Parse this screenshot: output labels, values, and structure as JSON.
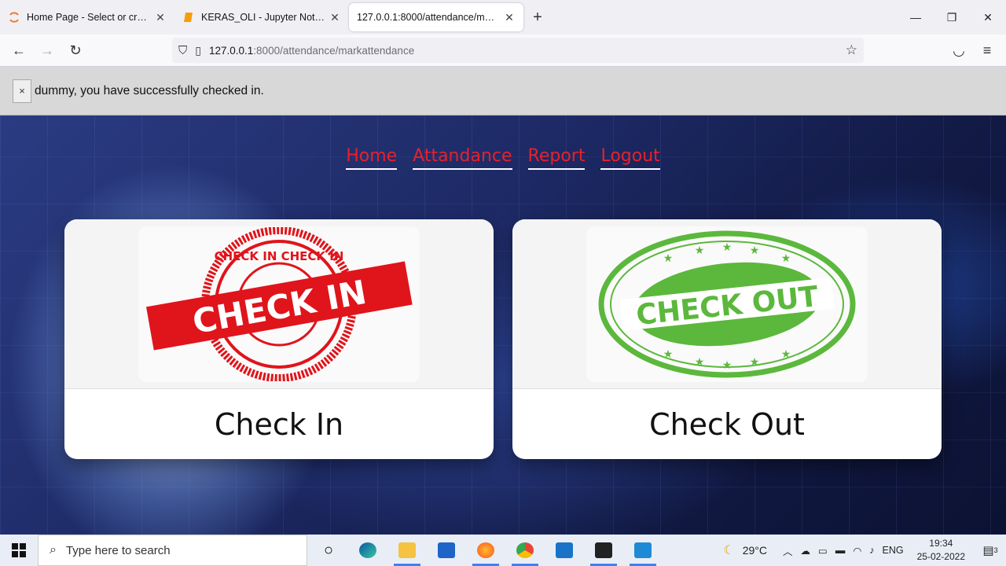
{
  "browser": {
    "tabs": [
      {
        "title": "Home Page - Select or create a notebook",
        "icon": "jupyter-icon",
        "active": false
      },
      {
        "title": "KERAS_OLI - Jupyter Notebook",
        "icon": "notebook-icon",
        "active": false
      },
      {
        "title": "127.0.0.1:8000/attendance/markattendance",
        "icon": "",
        "active": true
      }
    ],
    "url_host": "127.0.0.1",
    "url_path": ":8000/attendance/markattendance"
  },
  "alert": {
    "close_label": "×",
    "message": "dummy, you have successfully checked in."
  },
  "menu": {
    "items": [
      "Home",
      "Attandance",
      "Report",
      "Logout"
    ]
  },
  "cards": {
    "checkin": {
      "label": "Check In",
      "stamp_text": "CHECK IN",
      "ring_text": "CHECK IN  CHECK IN",
      "color": "#e0141b"
    },
    "checkout": {
      "label": "Check Out",
      "stamp_text": "CHECK OUT",
      "color": "#5bb83c"
    }
  },
  "taskbar": {
    "search_placeholder": "Type here to search",
    "weather": "29°C",
    "language": "ENG",
    "time": "19:34",
    "date": "25-02-2022",
    "notification_count": "3"
  }
}
